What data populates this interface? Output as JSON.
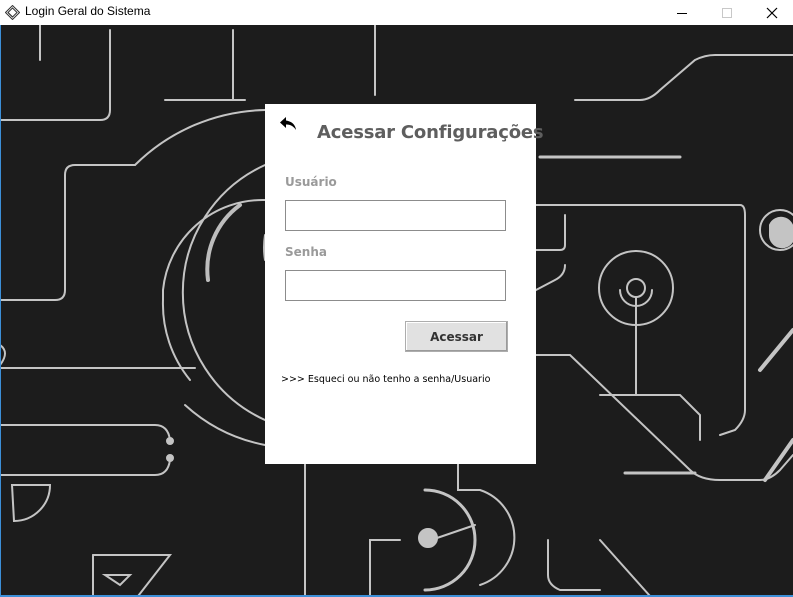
{
  "window": {
    "title": "Login Geral do Sistema",
    "controls": {
      "minimize_icon": "minimize-icon",
      "maximize_icon": "maximize-icon",
      "close_icon": "close-icon"
    }
  },
  "background": {
    "color": "#1c1c1c",
    "line_color": "#c8c8c8",
    "pattern": "circuit-lines"
  },
  "panel": {
    "back_icon": "back-arrow-icon",
    "title": "Acessar Configurações",
    "username": {
      "label": "Usuário",
      "value": "",
      "placeholder": ""
    },
    "password": {
      "label": "Senha",
      "value": "",
      "placeholder": ""
    },
    "submit_label": "Acessar",
    "forgot_link": ">>> Esqueci ou não tenho a senha/Usuario"
  }
}
